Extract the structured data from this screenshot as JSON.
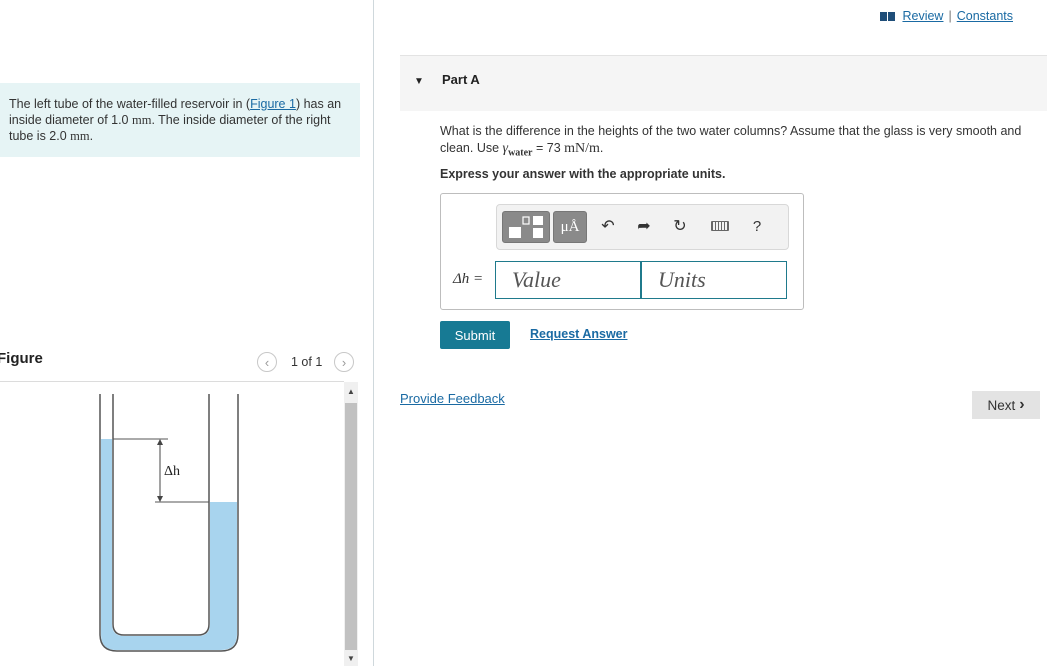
{
  "problem": {
    "text_before": "The left tube of the water-filled reservoir in (",
    "figure_link": "Figure 1",
    "text_middle": ") has an inside diameter of 1.0 ",
    "unit_mm_1": "mm",
    "text_after": ". The inside diameter of the right tube is 2.0 ",
    "unit_mm_2": "mm",
    "text_end": "."
  },
  "figure": {
    "label": "Figure",
    "counter": "1 of 1",
    "delta_label": "Δh",
    "water_color": "#a8d4ee"
  },
  "top_links": {
    "review": "Review",
    "separator": "|",
    "constants": "Constants"
  },
  "part": {
    "title": "Part A"
  },
  "question": {
    "text_before": "What is the difference in the heights of the two water columns? Assume that the glass is very smooth and clean. Use ",
    "gamma": "γ",
    "gamma_sub": "water",
    "text_equals": " = 73 ",
    "unit": "mN/m",
    "text_end": "."
  },
  "instruction": "Express your answer with the appropriate units.",
  "toolbar": {
    "symbol_label": "μÅ",
    "help_label": "?"
  },
  "answer": {
    "variable_label": "Δh =",
    "value_placeholder": "Value",
    "units_placeholder": "Units"
  },
  "actions": {
    "submit_label": "Submit",
    "request_answer_label": "Request Answer",
    "feedback_label": "Provide Feedback",
    "next_label": "Next"
  },
  "colors": {
    "accent": "#177a94",
    "link": "#1a6aa3",
    "problem_bg": "#e6f4f5"
  }
}
